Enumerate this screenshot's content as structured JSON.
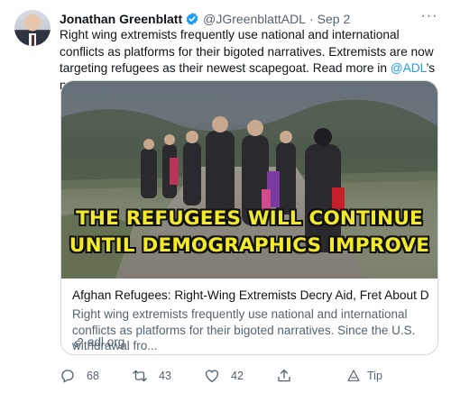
{
  "tweet": {
    "author_name": "Jonathan Greenblatt",
    "handle": "@JGreenblattADL",
    "separator": "·",
    "date": "Sep 2",
    "more": "···",
    "text_part1": "Right wing extremists frequently use national and international conflicts as platforms for their bigoted narratives. Extremists are now targeting refugees as their newest scapegoat. Read more in ",
    "mention": "@ADL",
    "text_part2": "’s newest blog post."
  },
  "card": {
    "image_caption_line1": "THE REFUGEES WILL CONTINUE",
    "image_caption_line2": "UNTIL DEMOGRAPHICS IMPROVE",
    "title": "Afghan Refugees: Right-Wing Extremists Decry Aid, Fret About Demo...",
    "description": "Right wing extremists frequently use national and international conflicts as platforms for their bigoted narratives. Since the U.S. withdrawal fro...",
    "domain": "adl.org"
  },
  "actions": {
    "reply_count": "68",
    "retweet_count": "43",
    "like_count": "42",
    "tip_label": "Tip"
  },
  "colors": {
    "accent": "#1d9bf0",
    "secondary_text": "#536471",
    "caption": "#f3ea2a"
  },
  "icons": [
    "verified-badge-icon",
    "more-icon",
    "link-icon",
    "reply-icon",
    "retweet-icon",
    "like-icon",
    "share-icon",
    "tip-icon"
  ]
}
